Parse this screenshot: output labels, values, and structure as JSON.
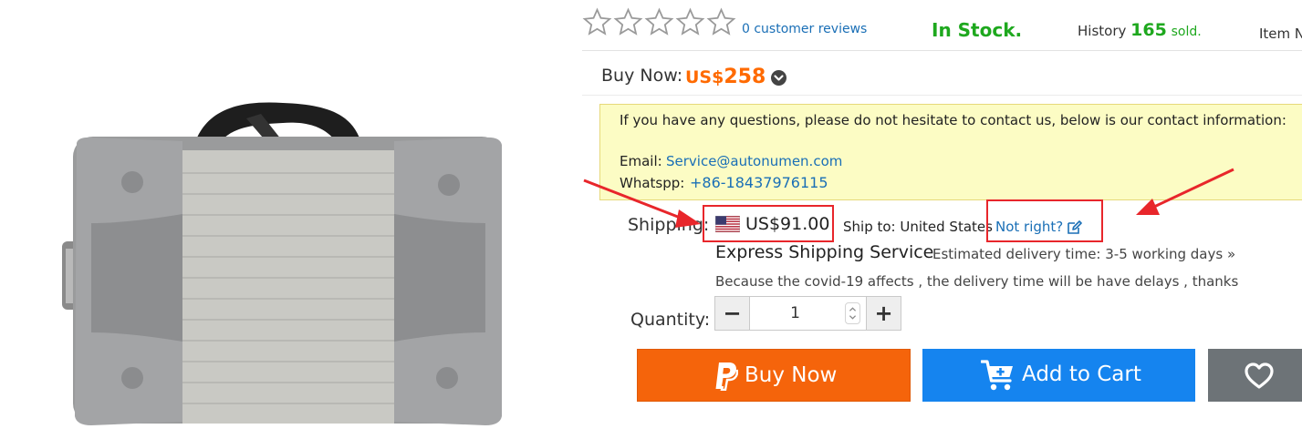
{
  "rating": {
    "reviews_text": "0 customer reviews",
    "star_count": 5,
    "filled": 0
  },
  "stock": {
    "status": "In Stock."
  },
  "history": {
    "prefix": "History",
    "count": "165",
    "suffix": "sold."
  },
  "item_no": {
    "label": "Item N"
  },
  "buy_now": {
    "label": "Buy Now:",
    "currency": "US$",
    "amount": "258"
  },
  "contact": {
    "intro": "If you have any questions, please do not hesitate to contact us, below is our contact information:",
    "email_label": "Email:",
    "email": "Service@autonumen.com",
    "whatsapp_label": "Whatspp:",
    "whatsapp": "+86-18437976115"
  },
  "shipping": {
    "label": "Shipping:",
    "price": "US$91.00",
    "ship_to": "Ship to: United States",
    "not_right": "Not right?",
    "service": "Express Shipping Service",
    "estimate": "Estimated delivery time: 3-5 working days »",
    "note": "Because the covid-19 affects , the delivery time will be have delays , thanks"
  },
  "quantity": {
    "label": "Quantity:",
    "value": "1",
    "minus": "−",
    "plus": "+"
  },
  "actions": {
    "buy_now": "Buy Now",
    "add_to_cart": "Add to Cart"
  },
  "colors": {
    "price_orange": "#ff6a00",
    "stock_green": "#1ea81e",
    "link_blue": "#1a6fb6",
    "buy_button": "#f5640b",
    "cart_button": "#1584ef",
    "wishlist_button": "#6d7377",
    "highlight_red": "#e8262b"
  }
}
